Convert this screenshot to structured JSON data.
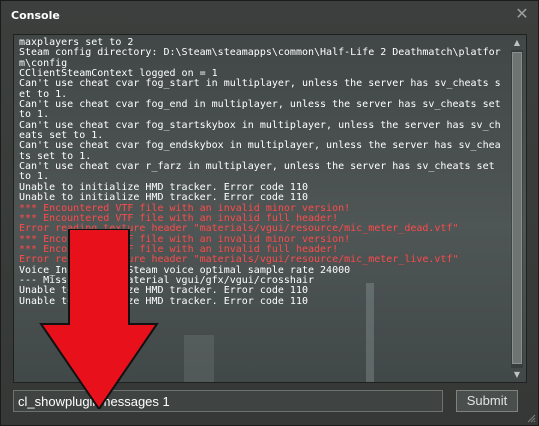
{
  "window": {
    "title": "Console",
    "close_icon": "close-icon"
  },
  "console": {
    "lines": [
      {
        "text": "maxplayers set to 2",
        "kind": "normal"
      },
      {
        "text": "Steam config directory: D:\\Steam\\steamapps\\common\\Half-Life 2 Deathmatch\\platform\\config",
        "kind": "normal"
      },
      {
        "text": "CClientSteamContext logged on = 1",
        "kind": "normal"
      },
      {
        "text": "Can't use cheat cvar fog_start in multiplayer, unless the server has sv_cheats set to 1.",
        "kind": "normal"
      },
      {
        "text": "Can't use cheat cvar fog_end in multiplayer, unless the server has sv_cheats set to 1.",
        "kind": "normal"
      },
      {
        "text": "Can't use cheat cvar fog_startskybox in multiplayer, unless the server has sv_cheats set to 1.",
        "kind": "normal"
      },
      {
        "text": "Can't use cheat cvar fog_endskybox in multiplayer, unless the server has sv_cheats set to 1.",
        "kind": "normal"
      },
      {
        "text": "Can't use cheat cvar r_farz in multiplayer, unless the server has sv_cheats set to 1.",
        "kind": "normal"
      },
      {
        "text": "Unable to initialize HMD tracker. Error code 110",
        "kind": "normal"
      },
      {
        "text": "Unable to initialize HMD tracker. Error code 110",
        "kind": "normal"
      },
      {
        "text": "*** Encountered VTF file with an invalid minor version!",
        "kind": "error"
      },
      {
        "text": "*** Encountered VTF file with an invalid full header!",
        "kind": "error"
      },
      {
        "text": "Error reading texture header \"materials/vgui/resource/mic_meter_dead.vtf\"",
        "kind": "error"
      },
      {
        "text": "*** Encountered VTF file with an invalid minor version!",
        "kind": "error"
      },
      {
        "text": "*** Encountered VTF file with an invalid full header!",
        "kind": "error"
      },
      {
        "text": "Error reading texture header \"materials/vgui/resource/mic_meter_live.vtf\"",
        "kind": "error"
      },
      {
        "text": "Voice_Init: Using Steam voice optimal sample rate 24000",
        "kind": "normal"
      },
      {
        "text": "--- Missing Vgui material vgui/gfx/vgui/crosshair",
        "kind": "normal"
      },
      {
        "text": "Unable to initialize HMD tracker. Error code 110",
        "kind": "normal"
      },
      {
        "text": "Unable to initialize HMD tracker. Error code 110",
        "kind": "normal"
      }
    ],
    "colors": {
      "normal": "#ffffff",
      "error": "#ff4a4a"
    }
  },
  "command": {
    "value": "cl_showpluginmessages 1",
    "submit_label": "Submit"
  },
  "scrollbar": {
    "up_icon": "scroll-up-icon",
    "down_icon": "scroll-down-icon",
    "up_glyph": "▲",
    "down_glyph": "▼"
  },
  "annotation": {
    "arrow_icon": "red-arrow-icon",
    "arrow_color": "#e8101a"
  }
}
